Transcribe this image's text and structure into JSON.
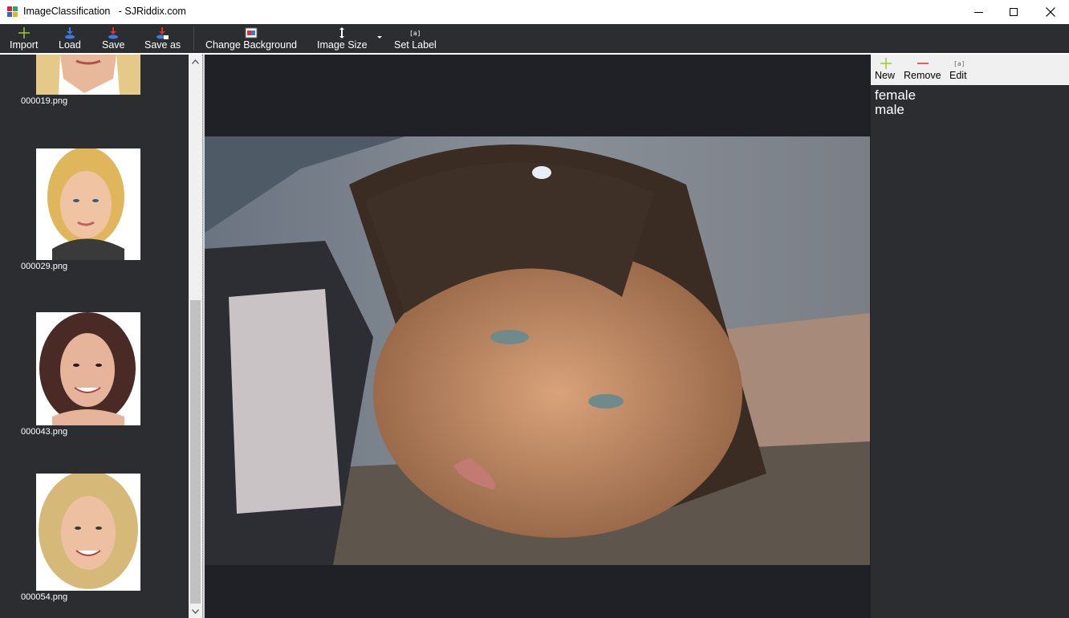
{
  "window": {
    "title": "ImageClassification   - SJRiddix.com",
    "minimize_icon": "minimize-icon",
    "maximize_icon": "maximize-icon",
    "close_icon": "close-icon"
  },
  "toolbar": {
    "import_label": "Import",
    "load_label": "Load",
    "save_label": "Save",
    "save_as_label": "Save as",
    "change_background_label": "Change Background",
    "image_size_label": "Image Size",
    "set_label_label": "Set Label"
  },
  "thumbnails": [
    {
      "filename": "000019.png"
    },
    {
      "filename": "000029.png"
    },
    {
      "filename": "000043.png"
    },
    {
      "filename": "000054.png"
    }
  ],
  "label_panel": {
    "new_label": "New",
    "remove_label": "Remove",
    "edit_label": "Edit",
    "labels": [
      "female",
      "male"
    ]
  },
  "colors": {
    "toolbar_bg": "#2b2d31",
    "canvas_bg": "#1f2126",
    "add_icon": "#9acd32",
    "remove_icon": "#e03030"
  }
}
